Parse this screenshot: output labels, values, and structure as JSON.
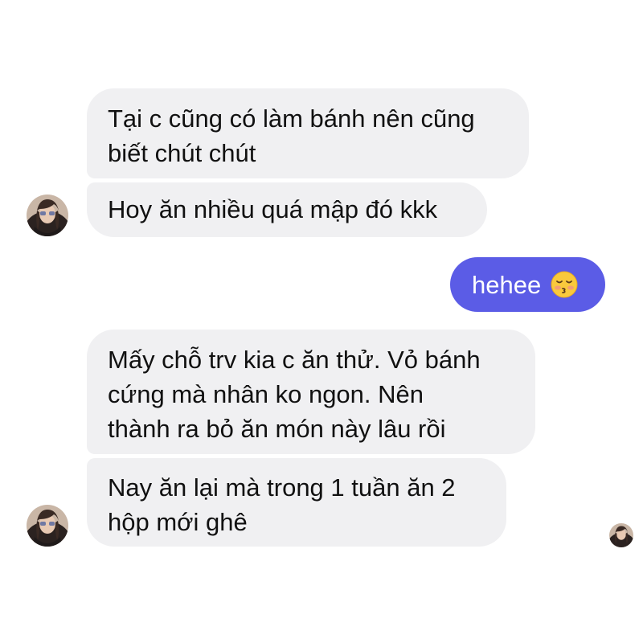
{
  "conversation": {
    "messages": [
      {
        "sender": "other",
        "lines": [
          "Tại c cũng có làm bánh nên cũng",
          "biết chút chút"
        ]
      },
      {
        "sender": "other",
        "lines": [
          "Hoy ăn nhiều quá mập đó kkk"
        ]
      },
      {
        "sender": "me",
        "text": "hehee",
        "emoji": "kissing-face-with-closed-eyes"
      },
      {
        "sender": "other",
        "lines": [
          "Mấy chỗ trv kia c ăn thử. Vỏ bánh",
          "cứng mà nhân ko ngon. Nên",
          "thành ra bỏ ăn món này lâu rồi"
        ]
      },
      {
        "sender": "other",
        "lines": [
          "Nay ăn lại mà trong 1 tuần ăn 2",
          "hộp mới ghê"
        ]
      }
    ]
  },
  "colors": {
    "incoming_bubble": "#f0f0f2",
    "outgoing_bubble": "#5b5ce6",
    "text": "#111111"
  }
}
